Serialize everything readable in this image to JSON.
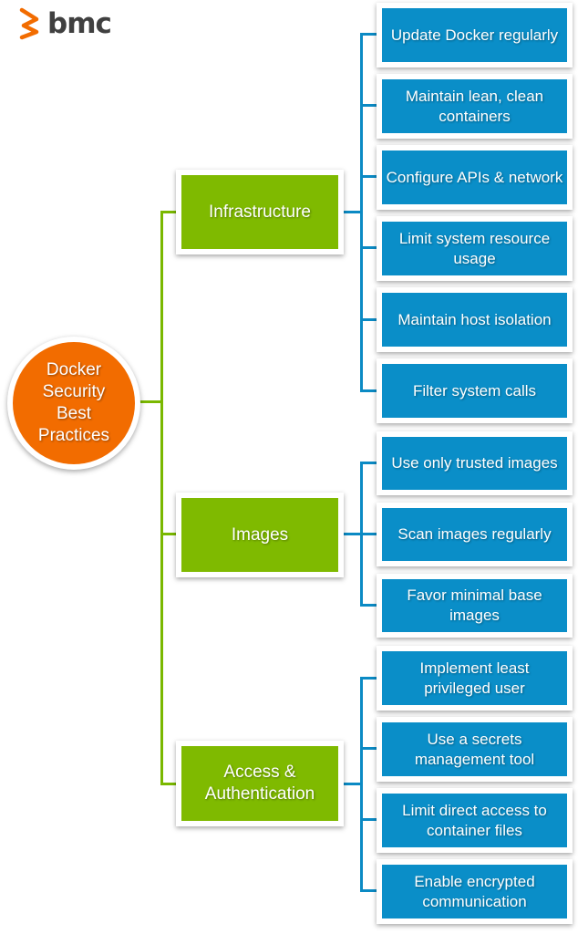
{
  "brand": {
    "name": "bmc",
    "icon": "bmc-chevron-logo",
    "accent": "#f26c00"
  },
  "colors": {
    "root": "#f26c00",
    "category": "#7fba00",
    "leaf": "#0a8ec8",
    "green_line": "#7ab800",
    "blue_line": "#0b8ac4"
  },
  "root": {
    "label": "Docker Security Best Practices",
    "lines": "Docker\nSecurity\nBest\nPractices"
  },
  "categories": [
    {
      "label": "Infrastructure",
      "items": [
        "Update Docker regularly",
        "Maintain lean, clean containers",
        "Configure APIs & network",
        "Limit system resource usage",
        "Maintain host isolation",
        "Filter system calls"
      ]
    },
    {
      "label": "Images",
      "items": [
        "Use only trusted images",
        "Scan images regularly",
        "Favor minimal base images"
      ]
    },
    {
      "label": "Access & Authentication",
      "items": [
        "Implement least privileged user",
        "Use a secrets management tool",
        "Limit direct access to container files",
        "Enable encrypted communication"
      ]
    }
  ]
}
